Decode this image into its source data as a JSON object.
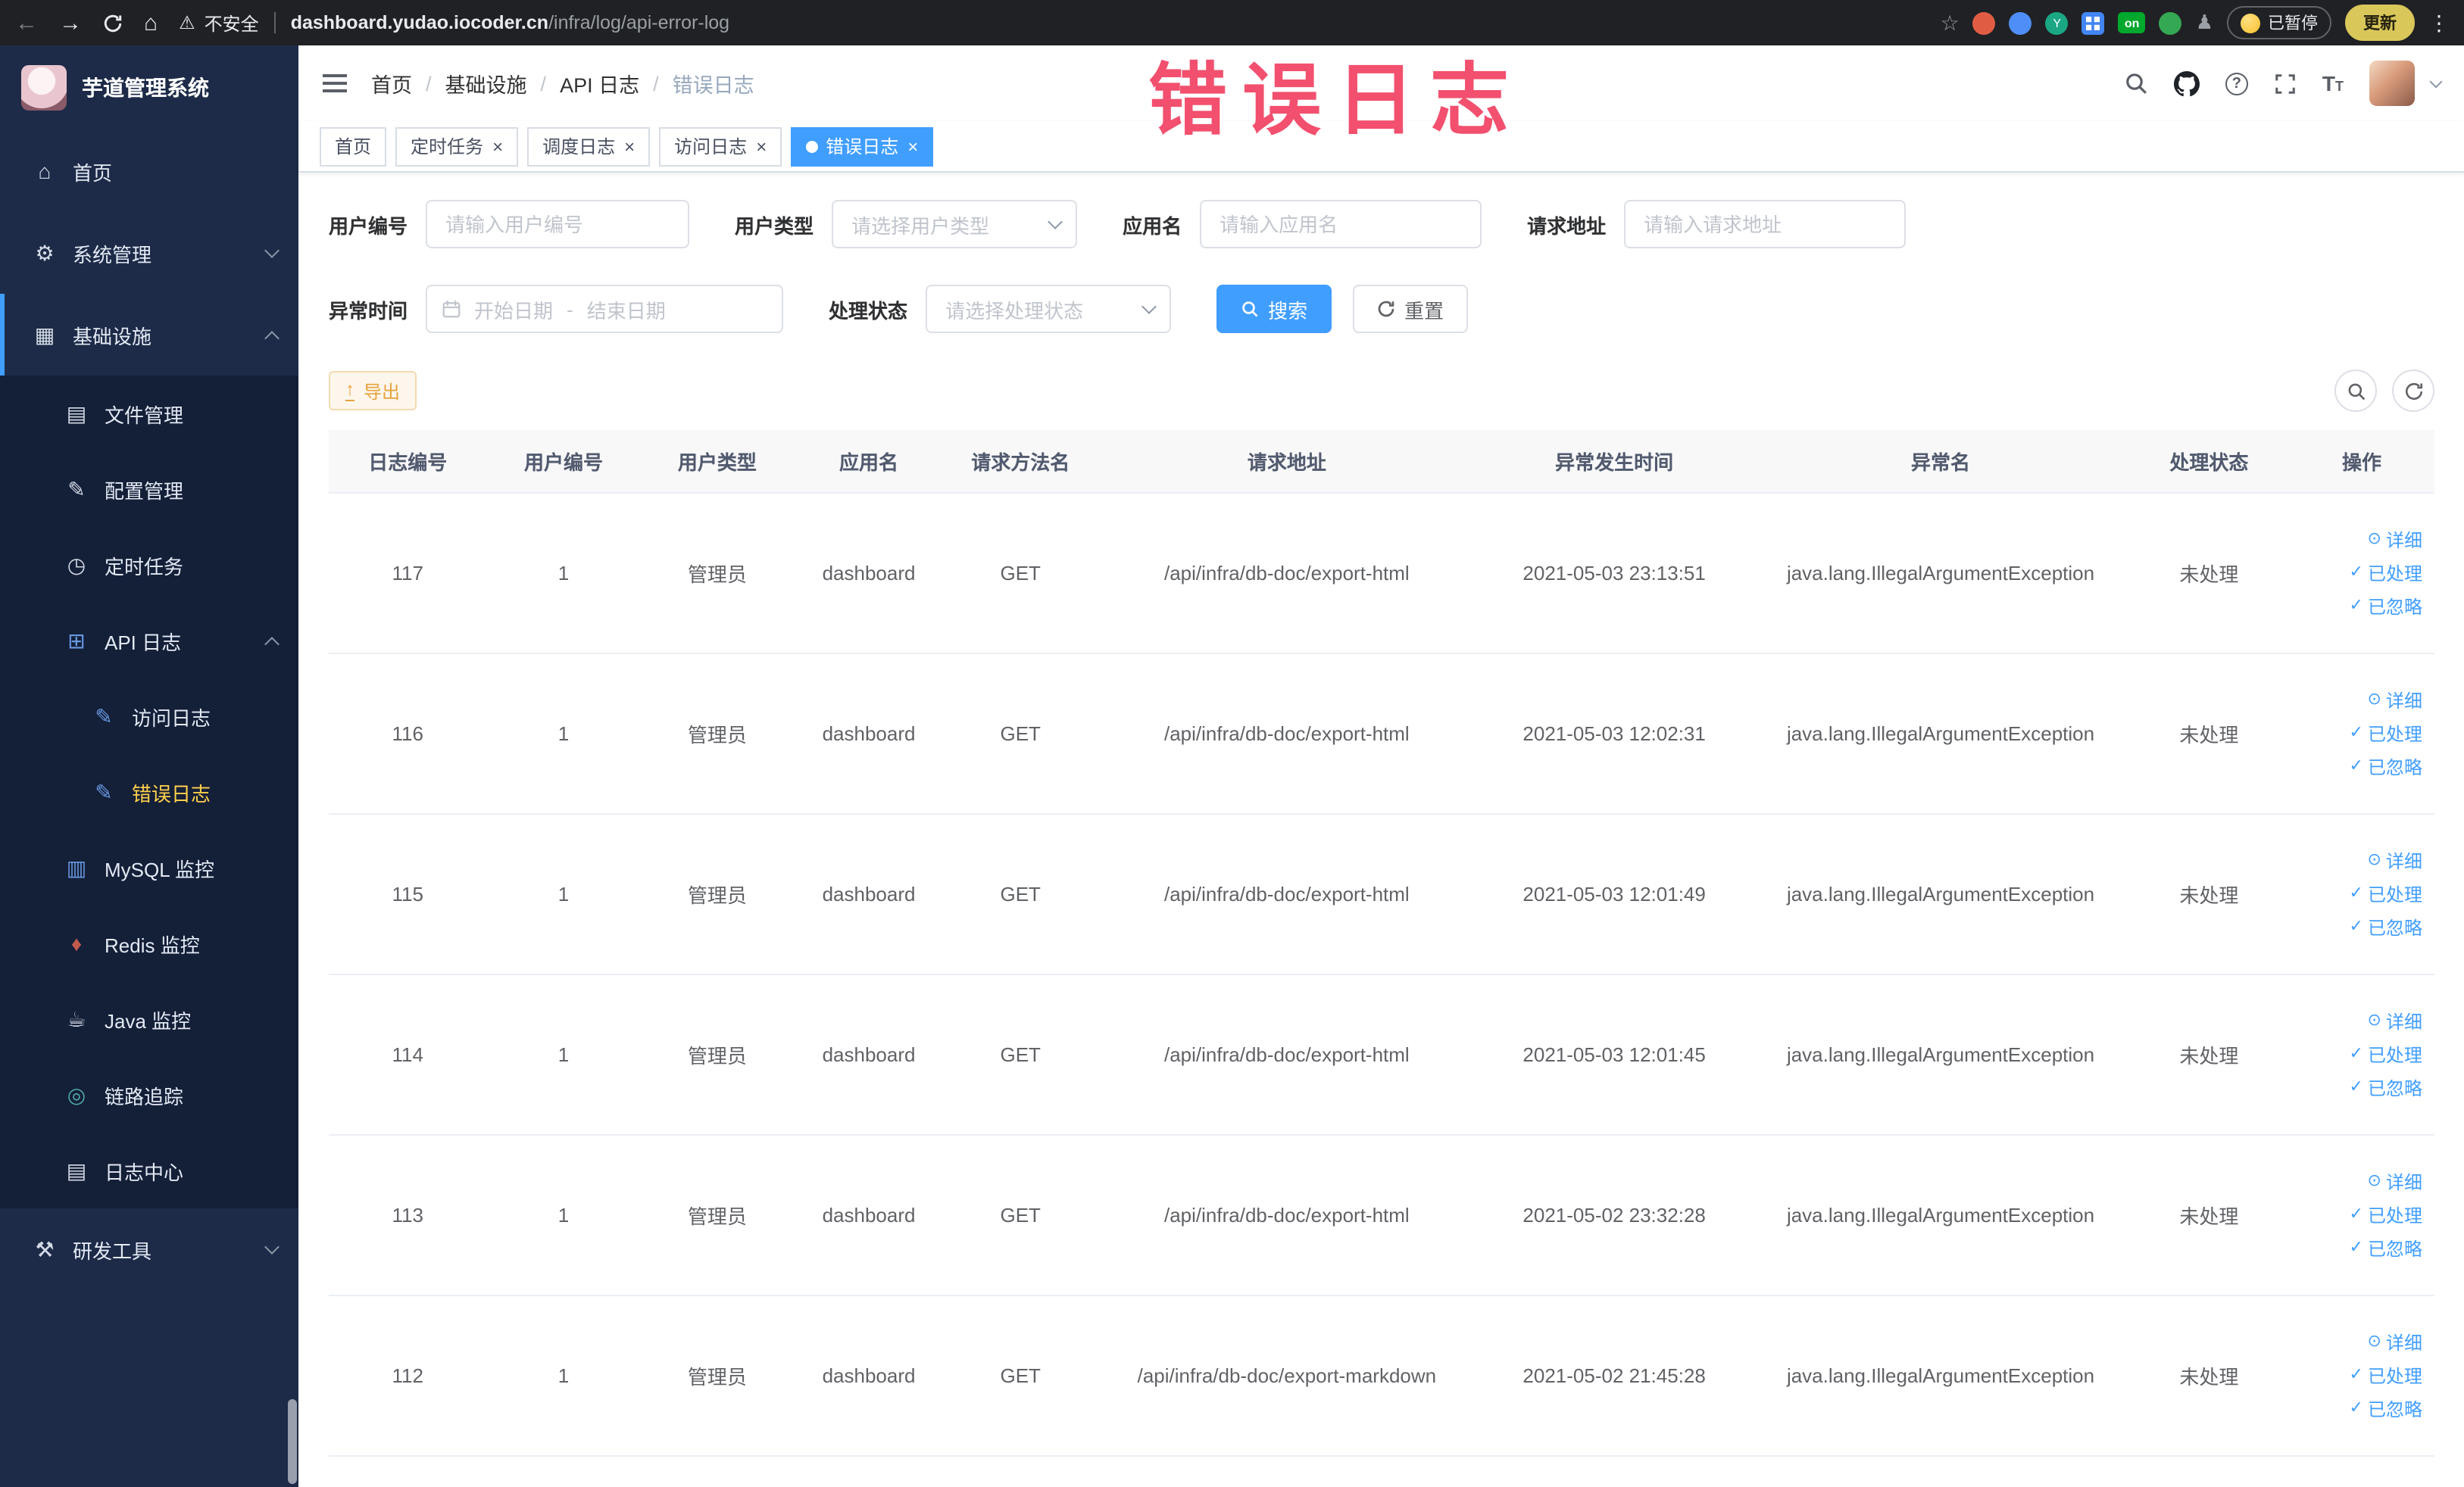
{
  "palette": {
    "accent": "#409eff",
    "warning": "#e6a23c",
    "sidebar_active": "#ffd04b",
    "tab_active_bg": "#409eff",
    "annotation_color": "#f2506e"
  },
  "browser": {
    "security_label": "不安全",
    "url_host": "dashboard.yudao.iocoder.cn",
    "url_path": "/infra/log/api-error-log",
    "extension_badge_on": "on",
    "extension_badge_y": "Y",
    "sync_paused_label": "已暂停",
    "update_label": "更新"
  },
  "annotation": {
    "text": "错误日志"
  },
  "sidebar": {
    "logo_title": "芋道管理系统",
    "items": [
      {
        "key": "home",
        "label": "首页",
        "icon": "home-icon",
        "level": 1
      },
      {
        "key": "system",
        "label": "系统管理",
        "icon": "gear-icon",
        "level": 1,
        "chevron": "down"
      },
      {
        "key": "infra",
        "label": "基础设施",
        "icon": "infra-icon",
        "level": 1,
        "chevron": "up",
        "active_trail": true
      },
      {
        "key": "file",
        "label": "文件管理",
        "icon": "file-icon",
        "level": 2
      },
      {
        "key": "config",
        "label": "配置管理",
        "icon": "config-icon",
        "level": 2
      },
      {
        "key": "job",
        "label": "定时任务",
        "icon": "job-icon",
        "level": 2
      },
      {
        "key": "api-log",
        "label": "API 日志",
        "icon": "api-log-icon",
        "level": 2,
        "chevron": "up"
      },
      {
        "key": "access-log",
        "label": "访问日志",
        "icon": "access-log-icon",
        "level": 3
      },
      {
        "key": "error-log",
        "label": "错误日志",
        "icon": "error-log-icon",
        "level": 3,
        "active": true
      },
      {
        "key": "mysql",
        "label": "MySQL 监控",
        "icon": "mysql-icon",
        "level": 2
      },
      {
        "key": "redis",
        "label": "Redis 监控",
        "icon": "redis-icon",
        "level": 2
      },
      {
        "key": "java",
        "label": "Java 监控",
        "icon": "java-icon",
        "level": 2
      },
      {
        "key": "trace",
        "label": "链路追踪",
        "icon": "trace-icon",
        "level": 2
      },
      {
        "key": "log-center",
        "label": "日志中心",
        "icon": "log-center-icon",
        "level": 2
      },
      {
        "key": "dev-tools",
        "label": "研发工具",
        "icon": "dev-tools-icon",
        "level": 1,
        "chevron": "down"
      }
    ]
  },
  "header": {
    "breadcrumb": [
      "首页",
      "基础设施",
      "API 日志",
      "错误日志"
    ]
  },
  "tabs": [
    {
      "label": "首页",
      "closable": false,
      "active": false
    },
    {
      "label": "定时任务",
      "closable": true,
      "active": false
    },
    {
      "label": "调度日志",
      "closable": true,
      "active": false
    },
    {
      "label": "访问日志",
      "closable": true,
      "active": false
    },
    {
      "label": "错误日志",
      "closable": true,
      "active": true
    }
  ],
  "filters": {
    "user_id": {
      "label": "用户编号",
      "placeholder": "请输入用户编号"
    },
    "user_type": {
      "label": "用户类型",
      "placeholder": "请选择用户类型"
    },
    "app_name": {
      "label": "应用名",
      "placeholder": "请输入应用名"
    },
    "request_url": {
      "label": "请求地址",
      "placeholder": "请输入请求地址"
    },
    "exception_time": {
      "label": "异常时间",
      "start_placeholder": "开始日期",
      "separator": "-",
      "end_placeholder": "结束日期"
    },
    "process_status": {
      "label": "处理状态",
      "placeholder": "请选择处理状态"
    },
    "search_label": "搜索",
    "reset_label": "重置"
  },
  "toolbar": {
    "export_label": "导出"
  },
  "table": {
    "columns": [
      "日志编号",
      "用户编号",
      "用户类型",
      "应用名",
      "请求方法名",
      "请求地址",
      "异常发生时间",
      "异常名",
      "处理状态",
      "操作"
    ],
    "actions": [
      {
        "key": "detail",
        "label": "详细"
      },
      {
        "key": "processed",
        "label": "已处理"
      },
      {
        "key": "ignored",
        "label": "已忽略"
      }
    ],
    "rows": [
      {
        "id": "117",
        "user_id": "1",
        "user_type": "管理员",
        "app": "dashboard",
        "method": "GET",
        "url": "/api/infra/db-doc/export-html",
        "time": "2021-05-03 23:13:51",
        "exception": "java.lang.IllegalArgumentException",
        "status": "未处理"
      },
      {
        "id": "116",
        "user_id": "1",
        "user_type": "管理员",
        "app": "dashboard",
        "method": "GET",
        "url": "/api/infra/db-doc/export-html",
        "time": "2021-05-03 12:02:31",
        "exception": "java.lang.IllegalArgumentException",
        "status": "未处理"
      },
      {
        "id": "115",
        "user_id": "1",
        "user_type": "管理员",
        "app": "dashboard",
        "method": "GET",
        "url": "/api/infra/db-doc/export-html",
        "time": "2021-05-03 12:01:49",
        "exception": "java.lang.IllegalArgumentException",
        "status": "未处理"
      },
      {
        "id": "114",
        "user_id": "1",
        "user_type": "管理员",
        "app": "dashboard",
        "method": "GET",
        "url": "/api/infra/db-doc/export-html",
        "time": "2021-05-03 12:01:45",
        "exception": "java.lang.IllegalArgumentException",
        "status": "未处理"
      },
      {
        "id": "113",
        "user_id": "1",
        "user_type": "管理员",
        "app": "dashboard",
        "method": "GET",
        "url": "/api/infra/db-doc/export-html",
        "time": "2021-05-02 23:32:28",
        "exception": "java.lang.IllegalArgumentException",
        "status": "未处理"
      },
      {
        "id": "112",
        "user_id": "1",
        "user_type": "管理员",
        "app": "dashboard",
        "method": "GET",
        "url": "/api/infra/db-doc/export-markdown",
        "time": "2021-05-02 21:45:28",
        "exception": "java.lang.IllegalArgumentException",
        "status": "未处理"
      }
    ]
  }
}
